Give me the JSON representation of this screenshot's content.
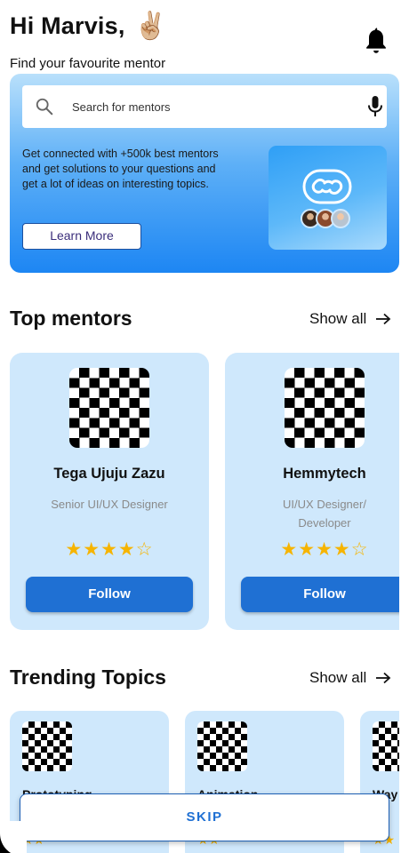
{
  "header": {
    "greeting": "Hi Marvis,",
    "emoji": "✌🏼",
    "subtitle": "Find your favourite mentor",
    "bell_icon": "bell-icon"
  },
  "hero": {
    "search_placeholder": "Search for mentors",
    "search_icon": "search-icon",
    "mic_icon": "microphone-icon",
    "description": "Get connected with +500k best mentors and get solutions to your questions and get a lot of ideas on interesting topics.",
    "cta_label": "Learn More",
    "card_icon": "link-icon"
  },
  "top_mentors": {
    "title": "Top mentors",
    "show_all": "Show all",
    "items": [
      {
        "name": "Tega Ujuju Zazu",
        "role": "Senior UI/UX Designer",
        "rating": 4,
        "stars": "★★★★☆",
        "follow_label": "Follow"
      },
      {
        "name": "Hemmytech",
        "role": "UI/UX Designer/ Developer",
        "rating": 4,
        "stars": "★★★★☆",
        "follow_label": "Follow"
      }
    ]
  },
  "trending": {
    "title": "Trending Topics",
    "show_all": "Show all",
    "items": [
      {
        "name": "Prototyping",
        "stars": "★★"
      },
      {
        "name": "Animation",
        "stars": "★★"
      },
      {
        "name": "Way",
        "sub": "s I",
        "stars": "★★"
      }
    ]
  },
  "skip_label": "SKIP",
  "colors": {
    "accent": "#1f70d3",
    "card_bg": "#cfe8fc",
    "star": "#f6b400"
  }
}
